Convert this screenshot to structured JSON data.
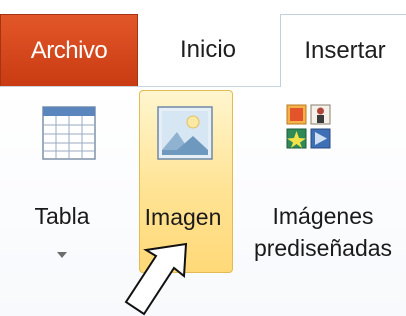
{
  "tabs": {
    "file": "Archivo",
    "home": "Inicio",
    "insert": "Insertar"
  },
  "ribbon": {
    "table_label": "Tabla",
    "image_label": "Imagen",
    "clipart_label_line1": "Imágenes",
    "clipart_label_line2": "prediseñadas"
  },
  "colors": {
    "file_tab": "#d24a1f",
    "hover_highlight": "#ffe394"
  }
}
